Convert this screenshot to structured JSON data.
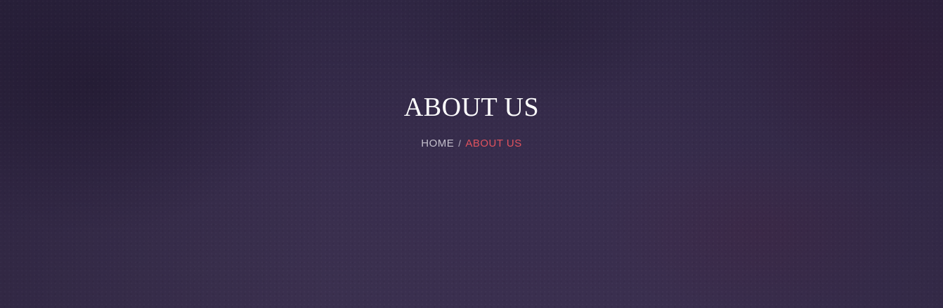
{
  "hero": {
    "title": "ABOUT US",
    "breadcrumb": {
      "home_label": "HOME",
      "separator": "/",
      "current_label": "ABOUT US"
    }
  },
  "colors": {
    "background": "#352a48",
    "title": "#ffffff",
    "breadcrumb_link": "#c4bfcc",
    "breadcrumb_active": "#e0525e"
  }
}
